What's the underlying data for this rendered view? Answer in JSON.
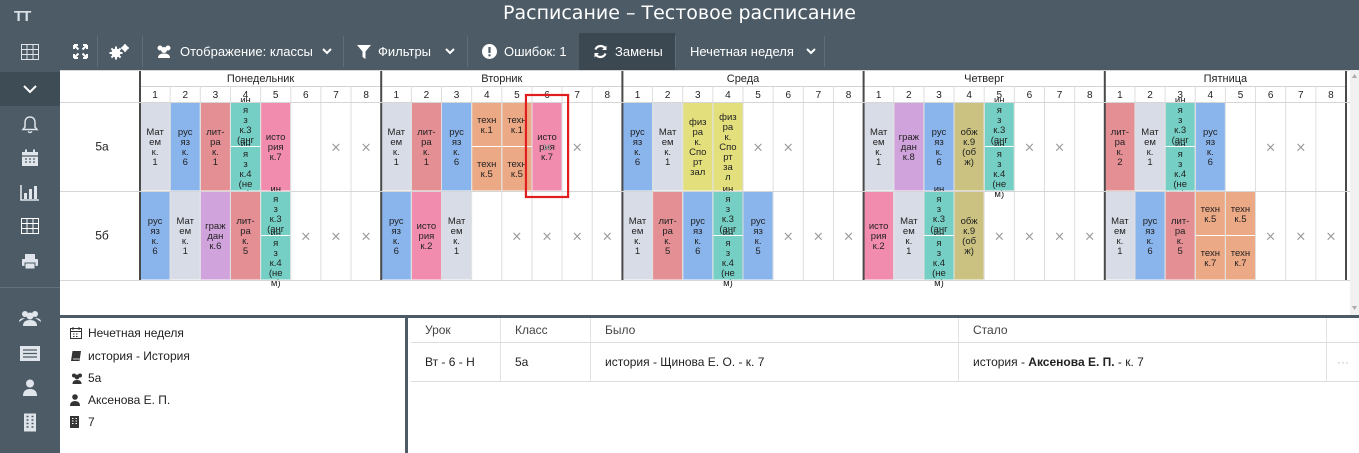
{
  "app": {
    "logo": "TT",
    "title": "Расписание – Тестовое расписание"
  },
  "sidebar": {
    "items": [
      "grid-icon",
      "chevron-down-icon",
      "bell-icon",
      "calendar-icon",
      "bar-chart-icon",
      "table-icon",
      "print-icon",
      "users-icon",
      "list-icon",
      "user-icon",
      "building-icon"
    ]
  },
  "toolbar": {
    "display_label": "Отображение: классы",
    "filters_label": "Фильтры",
    "errors_label": "Ошибок: 1",
    "subs_label": "Замены",
    "week_label": "Нечетная неделя"
  },
  "schedule": {
    "days": [
      "Понедельник",
      "Вторник",
      "Среда",
      "Четверг",
      "Пятница"
    ],
    "periods": [
      "1",
      "2",
      "3",
      "4",
      "5",
      "6",
      "7",
      "8"
    ],
    "empty_mark": "×",
    "rows": [
      {
        "class": "5а",
        "cells": [
          [
            {
              "t": "Мат ем к. 1",
              "c": "#d8dce6"
            }
          ],
          [
            {
              "t": "рус яз к. 6",
              "c": "#8ab4ec"
            }
          ],
          [
            {
              "t": "лит- ра к. 1",
              "c": "#e48f94"
            }
          ],
          [
            {
              "t": "ин я з к.3 (анг л)",
              "c": "#76cfc4"
            },
            {
              "t": "ин я з к.4 (не м)",
              "c": "#76cfc4"
            }
          ],
          [
            {
              "t": "исто рия к.7",
              "c": "#f28cae"
            }
          ],
          [],
          [],
          [],
          [
            {
              "t": "Мат ем к. 1",
              "c": "#d8dce6"
            }
          ],
          [
            {
              "t": "лит- ра к. 1",
              "c": "#e48f94"
            }
          ],
          [
            {
              "t": "рус яз к. 6",
              "c": "#8ab4ec"
            }
          ],
          [
            {
              "t": "техн к.1",
              "c": "#eca986"
            },
            {
              "t": "техн к.5",
              "c": "#eca986"
            }
          ],
          [
            {
              "t": "техн к.1",
              "c": "#eca986"
            },
            {
              "t": "техн к.5",
              "c": "#eca986"
            }
          ],
          [
            {
              "t": "исто рия к.7",
              "c": "#f28cae"
            }
          ],
          [],
          [],
          [
            {
              "t": "рус яз к. 6",
              "c": "#8ab4ec"
            }
          ],
          [
            {
              "t": "Мат ем к. 1",
              "c": "#d8dce6"
            }
          ],
          [
            {
              "t": "физ ра к. Спо рт зал",
              "c": "#e2df7c"
            }
          ],
          [
            {
              "t": "физ ра к. Спо рт за л",
              "c": "#e2df7c"
            }
          ],
          [],
          [],
          [],
          [],
          [
            {
              "t": "Мат ем к. 1",
              "c": "#d8dce6"
            }
          ],
          [
            {
              "t": "граж дан к.8",
              "c": "#d1a3dc"
            }
          ],
          [
            {
              "t": "рус яз к. 6",
              "c": "#8ab4ec"
            }
          ],
          [
            {
              "t": "обж к.9 (об ж)",
              "c": "#cbc281"
            }
          ],
          [
            {
              "t": "ин я з к.3 (анг л)",
              "c": "#76cfc4"
            },
            {
              "t": "ин я з к.4 (не м)",
              "c": "#76cfc4"
            }
          ],
          [],
          [],
          [],
          [
            {
              "t": "лит- ра к. 2",
              "c": "#e48f94"
            }
          ],
          [
            {
              "t": "Мат ем к. 1",
              "c": "#d8dce6"
            }
          ],
          [
            {
              "t": "ин я з к.3 (анг л)",
              "c": "#76cfc4"
            },
            {
              "t": "ин я з к.4 (не м)",
              "c": "#76cfc4"
            }
          ],
          [
            {
              "t": "рус яз к. 6",
              "c": "#8ab4ec"
            }
          ],
          [],
          [],
          [],
          []
        ]
      },
      {
        "class": "5б",
        "cells": [
          [
            {
              "t": "рус яз к. 6",
              "c": "#8ab4ec"
            }
          ],
          [
            {
              "t": "Мат ем к. 1",
              "c": "#d8dce6"
            }
          ],
          [
            {
              "t": "граж дан к.6",
              "c": "#d1a3dc"
            }
          ],
          [
            {
              "t": "лит- ра к. 5",
              "c": "#e48f94"
            }
          ],
          [
            {
              "t": "ин я з к.3 (анг л)",
              "c": "#76cfc4"
            },
            {
              "t": "ин я з к.4 (не м)",
              "c": "#76cfc4"
            }
          ],
          [],
          [],
          [],
          [
            {
              "t": "рус яз к. 6",
              "c": "#8ab4ec"
            }
          ],
          [
            {
              "t": "исто рия к.2",
              "c": "#f28cae"
            }
          ],
          [
            {
              "t": "Мат ем к. 1",
              "c": "#d8dce6"
            }
          ],
          [],
          [],
          [],
          [],
          [],
          [
            {
              "t": "Мат ем к. 1",
              "c": "#d8dce6"
            }
          ],
          [
            {
              "t": "лит- ра к. 5",
              "c": "#e48f94"
            }
          ],
          [
            {
              "t": "рус яз к. 6",
              "c": "#8ab4ec"
            }
          ],
          [
            {
              "t": "ин я з к.3 (анг л)",
              "c": "#76cfc4"
            },
            {
              "t": "ин я з к.4 (не м)",
              "c": "#76cfc4"
            }
          ],
          [
            {
              "t": "рус яз к. 5",
              "c": "#8ab4ec"
            }
          ],
          [],
          [],
          [],
          [
            {
              "t": "исто рия к.2",
              "c": "#f28cae"
            }
          ],
          [
            {
              "t": "Мат ем к. 1",
              "c": "#d8dce6"
            }
          ],
          [
            {
              "t": "ин я з к.3 (анг л)",
              "c": "#76cfc4"
            },
            {
              "t": "ин я з к.4 (не м)",
              "c": "#76cfc4"
            }
          ],
          [
            {
              "t": "обж к.9 (об ж)",
              "c": "#cbc281"
            }
          ],
          [],
          [],
          [],
          [],
          [
            {
              "t": "Мат ем к. 1",
              "c": "#d8dce6"
            }
          ],
          [
            {
              "t": "рус яз к. 6",
              "c": "#8ab4ec"
            }
          ],
          [
            {
              "t": "лит- ра к. 5",
              "c": "#e48f94"
            }
          ],
          [
            {
              "t": "техн к.5",
              "c": "#eca986"
            },
            {
              "t": "техн к.7",
              "c": "#eca986"
            }
          ],
          [
            {
              "t": "техн к.5",
              "c": "#eca986"
            },
            {
              "t": "техн к.7",
              "c": "#eca986"
            }
          ],
          [],
          [],
          []
        ]
      }
    ],
    "empty_x": [
      [
        6,
        7,
        13,
        14,
        20,
        21,
        29,
        30,
        37,
        38
      ],
      [
        5,
        6,
        7,
        12,
        13,
        14,
        15,
        21,
        22,
        23,
        28,
        29,
        30,
        31,
        37,
        38,
        39
      ]
    ],
    "highlight": {
      "row": 0,
      "slot": 13
    }
  },
  "details": {
    "week": "Нечетная неделя",
    "subject": "история - История",
    "class": "5а",
    "teacher": "Аксенова Е. П.",
    "room": "7"
  },
  "substitutions": {
    "headers": [
      "Урок",
      "Класс",
      "Было",
      "Стало"
    ],
    "rows": [
      {
        "lesson": "Вт - 6 - Н",
        "class": "5а",
        "was": "история - Щинова Е. О. - к. 7",
        "now_prefix": "история - ",
        "now_teacher": "Аксенова Е. П.",
        "now_suffix": " - к. 7",
        "more": "···"
      }
    ]
  }
}
